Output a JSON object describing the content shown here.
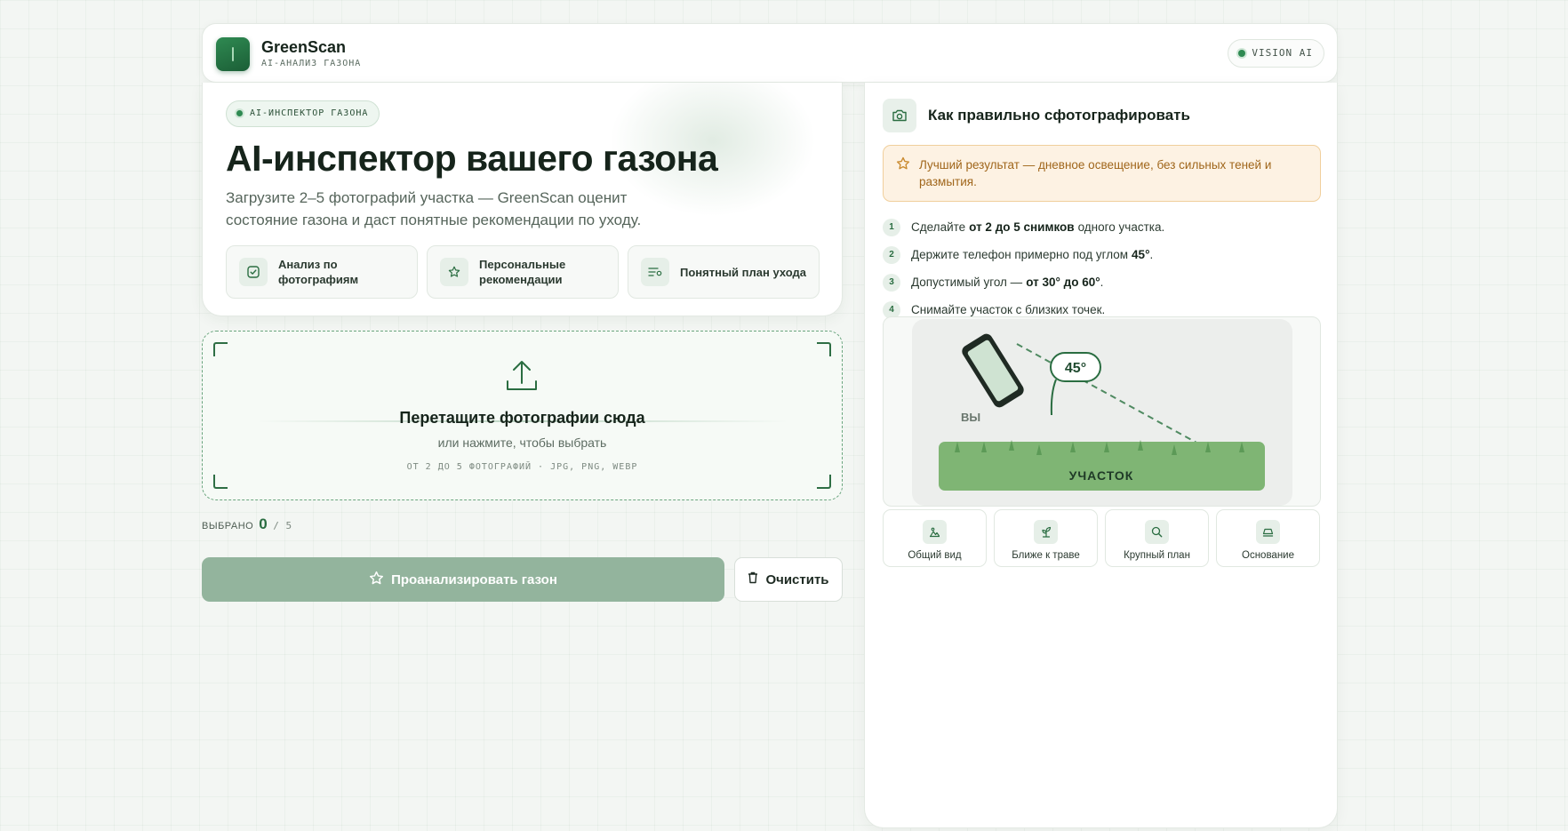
{
  "header": {
    "brand_name": "GreenScan",
    "brand_sub": "AI-АНАЛИЗ ГАЗОНА",
    "vision_badge": "VISION AI"
  },
  "hero": {
    "badge": "AI-ИНСПЕКТОР ГАЗОНА",
    "title": "AI-инспектор вашего газона",
    "description": "Загрузите 2–5 фотографий участка — GreenScan оценит состояние газона и даст понятные рекомендации по уходу.",
    "features": [
      {
        "label": "Анализ по фотографиям",
        "icon": "check-square-icon"
      },
      {
        "label": "Персональные рекомендации",
        "icon": "star-icon"
      },
      {
        "label": "Понятный план ухода",
        "icon": "list-icon"
      }
    ]
  },
  "dropzone": {
    "title": "Перетащите фотографии сюда",
    "subtitle": "или нажмите, чтобы выбрать",
    "hint": "ОТ 2 ДО 5 ФОТОГРАФИЙ · JPG, PNG, WEBP"
  },
  "counter": {
    "label": "ВЫБРАНО",
    "selected": "0",
    "total": "/ 5"
  },
  "actions": {
    "analyze": "Проанализировать газон",
    "clear": "Очистить"
  },
  "guide": {
    "title": "Как правильно сфотографировать",
    "tip": "Лучший результат — дневное освещение, без сильных теней и размытия.",
    "steps": [
      {
        "num": "1",
        "pre": "Сделайте",
        "bold": "от 2 до 5 снимков",
        "post": "одного участка."
      },
      {
        "num": "2",
        "pre": "Держите телефон примерно под углом",
        "bold": "45°",
        "post": "."
      },
      {
        "num": "3",
        "pre": "Допустимый угол —",
        "bold": "от 30° до 60°",
        "post": "."
      },
      {
        "num": "4",
        "pre": "Снимайте участок с близких точек.",
        "bold": "",
        "post": ""
      }
    ],
    "illustration": {
      "angle": "45°",
      "you_label": "ВЫ",
      "area_label": "УЧАСТОК"
    },
    "views": [
      {
        "label": "Общий вид",
        "icon": "landscape-icon"
      },
      {
        "label": "Ближе к траве",
        "icon": "sprout-icon"
      },
      {
        "label": "Крупный план",
        "icon": "magnifier-icon"
      },
      {
        "label": "Основание",
        "icon": "base-icon"
      }
    ]
  },
  "colors": {
    "accent": "#2a6d41",
    "button_disabled": "#93b49d",
    "tip_bg": "#fdf2e3",
    "tip_text": "#a0661b",
    "lawn": "#7fb574"
  }
}
